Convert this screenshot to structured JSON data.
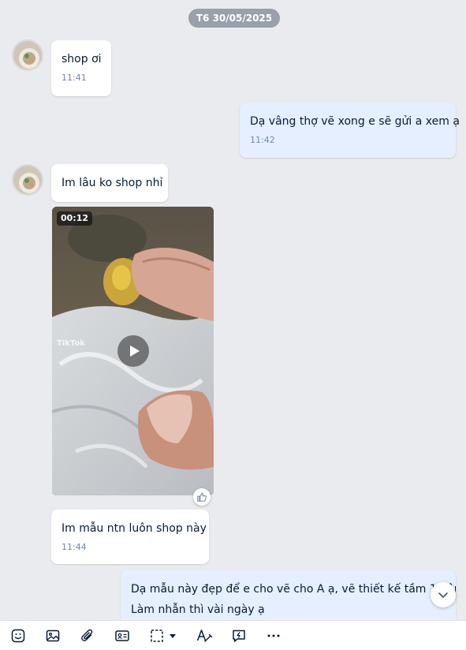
{
  "date_separator": "T6 30/05/2025",
  "messages": [
    {
      "sender": "other",
      "text": "shop ơi",
      "time": "11:41"
    },
    {
      "sender": "me",
      "text": "Dạ vâng thợ vẽ xong e sẽ gửi a xem ạ",
      "time": "11:42"
    },
    {
      "sender": "other",
      "text": "Im lâu ko shop nhỉ"
    },
    {
      "sender": "other",
      "type": "video",
      "duration": "00:12",
      "watermark": "TikTok"
    },
    {
      "sender": "other",
      "text": "Im mẫu ntn luôn shop này",
      "time": "11:44"
    },
    {
      "sender": "me",
      "lines": [
        "Dạ mẫu này đẹp để e cho vẽ cho A ạ, vẽ thiết kế tầm 1 hôm",
        "Làm nhẫn thì vài ngày ạ"
      ]
    }
  ],
  "toolbar": {
    "icons": [
      "sticker-icon",
      "image-icon",
      "attachment-icon",
      "contact-card-icon",
      "screenshot-icon",
      "dropdown-caret-icon",
      "text-format-icon",
      "quick-message-icon",
      "more-icon"
    ]
  },
  "colors": {
    "background": "#e9ebee",
    "my_bubble": "#e5efff",
    "other_bubble": "#ffffff",
    "timestamp": "#7589a3"
  }
}
